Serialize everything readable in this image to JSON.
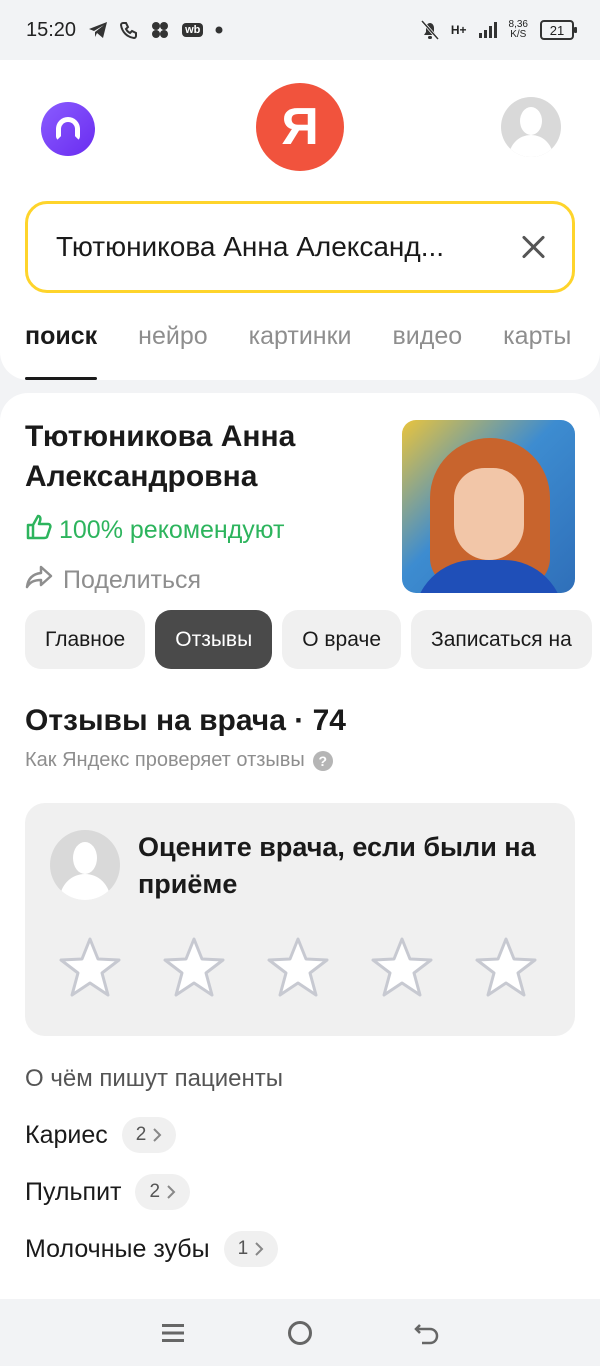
{
  "status_bar": {
    "time": "15:20",
    "left_icons": [
      "telegram-icon",
      "phone-icon",
      "apps-icon",
      "wb-icon",
      "dot-icon"
    ],
    "wb_label": "wb",
    "network_type": "H+",
    "speed_value": "8,36",
    "speed_unit": "K/S",
    "battery": "21"
  },
  "header": {
    "alice_icon": "alice-icon",
    "logo_letter": "Я",
    "brand_color": "#f1533d",
    "search": {
      "value": "Тютюникова Анна Александ..."
    },
    "tabs": [
      {
        "label": "поиск",
        "active": true
      },
      {
        "label": "нейро"
      },
      {
        "label": "картинки"
      },
      {
        "label": "видео"
      },
      {
        "label": "карты"
      }
    ]
  },
  "doctor": {
    "name": "Тютюникова Анна Александровна",
    "recommend": "100% рекомендуют",
    "recommend_color": "#2db45d",
    "share_label": "Поделиться"
  },
  "chips": [
    {
      "label": "Главное"
    },
    {
      "label": "Отзывы",
      "active": true
    },
    {
      "label": "О враче"
    },
    {
      "label": "Записаться на"
    }
  ],
  "reviews": {
    "title": "Отзывы на врача · 74",
    "subtitle": "Как Яндекс проверяет отзывы",
    "help_glyph": "?",
    "rate_prompt": "Оцените врача, если были на приёме",
    "stars_count": 5,
    "topics_title": "О чём пишут пациенты",
    "topics": [
      {
        "label": "Кариес",
        "count": "2"
      },
      {
        "label": "Пульпит",
        "count": "2"
      },
      {
        "label": "Молочные зубы",
        "count": "1"
      }
    ]
  },
  "nav_bar": {
    "icons": [
      "menu-icon",
      "home-icon",
      "back-icon"
    ]
  }
}
